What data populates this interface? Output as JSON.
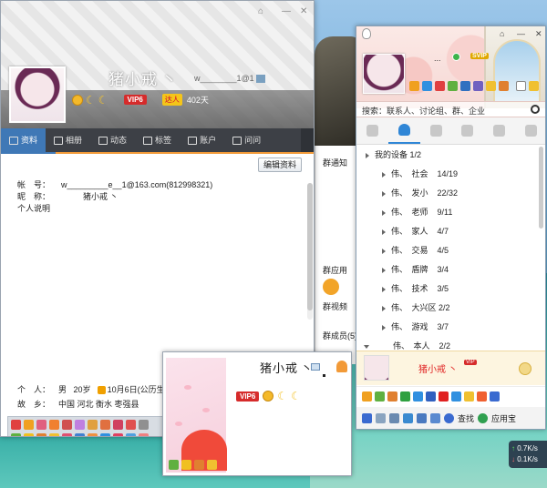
{
  "profile": {
    "nickname": "猪小戒",
    "nickname_suffix": "丶",
    "account_short": "w________1@1",
    "level_tags": {
      "vip": "VIP6",
      "daren": "达人",
      "days": "402天"
    },
    "tabs": [
      {
        "label": "资料",
        "icon": "id-card-icon"
      },
      {
        "label": "相册",
        "icon": "photo-icon"
      },
      {
        "label": "动态",
        "icon": "feed-icon"
      },
      {
        "label": "标签",
        "icon": "bookmark-icon"
      },
      {
        "label": "账户",
        "icon": "wallet-icon"
      },
      {
        "label": "问问",
        "icon": "question-icon"
      }
    ],
    "edit_button": "编辑资料",
    "fields": {
      "account_label": "帐　号：",
      "account_value": "w_________e__1@163.com(812998321)",
      "nick_label": "昵　称：",
      "nick_value": "猪小戒 丶",
      "desc_label": "个人说明"
    },
    "personal": {
      "person_label": "个　人：",
      "gender": "男",
      "age": "20岁",
      "birthday": "10月6日(公历生",
      "hometown_label": "故　乡：",
      "hometown": "中国 河北 衡水 枣强县"
    }
  },
  "group_panel": {
    "items": [
      "群通知",
      "群应用",
      "群视频",
      "群成员(5)"
    ]
  },
  "card": {
    "nickname": "猪小戒",
    "suffix": "丶",
    "vip": "VIP6"
  },
  "qq": {
    "nick": "...",
    "svip": "SVIP",
    "search_placeholder": "搜索：联系人、讨论组、群、企业",
    "groups": [
      {
        "name": "我的设备",
        "count": "1/2",
        "device": true
      },
      {
        "name": "伟、　社会",
        "count": "14/19"
      },
      {
        "name": "伟、　发小",
        "count": "22/32"
      },
      {
        "name": "伟、　老师",
        "count": "9/11"
      },
      {
        "name": "伟、　家人",
        "count": "4/7"
      },
      {
        "name": "伟、　交易",
        "count": "4/5"
      },
      {
        "name": "伟、　盾牌",
        "count": "3/4"
      },
      {
        "name": "伟、　技术",
        "count": "3/5"
      },
      {
        "name": "伟、　大兴区",
        "count": "2/2"
      },
      {
        "name": "伟、　游戏",
        "count": "3/7"
      },
      {
        "name": "伟、　本人",
        "count": "2/2",
        "open": true
      }
    ],
    "self_name": "猪小戒 丶",
    "self_vip": "VIP",
    "bottom": {
      "find": "查找",
      "appstore": "应用宝"
    }
  },
  "net": {
    "up": "0.7K/s",
    "down": "0.1K/s"
  }
}
